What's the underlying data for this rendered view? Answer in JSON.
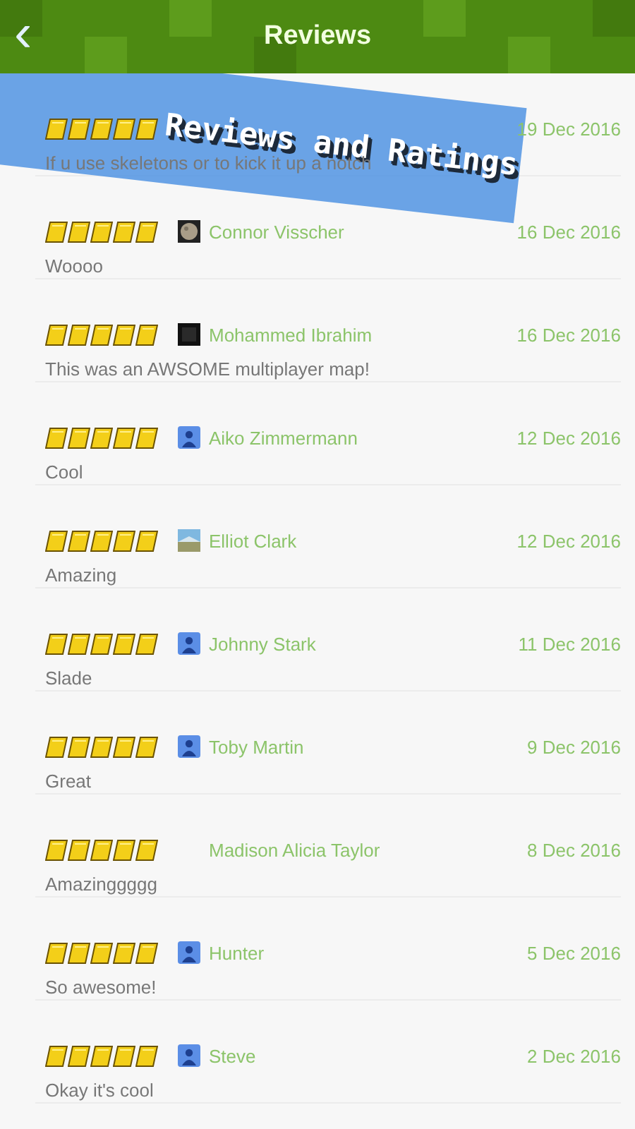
{
  "header": {
    "back_icon": "‹",
    "title": "Reviews"
  },
  "banner": {
    "text": "Reviews and Ratings"
  },
  "reviews": [
    {
      "stars": 5,
      "date": "19 Dec 2016",
      "comment": "If u use skeletons or to kick it up a notch"
    },
    {
      "stars": 5,
      "name": "Connor Visscher",
      "date": "16 Dec 2016",
      "comment": "Woooo"
    },
    {
      "stars": 5,
      "avatar": {
        "kind": "dark"
      },
      "name": "Mohammed Ibrahim",
      "date": "16 Dec 2016",
      "comment": "This was an AWSOME multiplayer map!"
    },
    {
      "stars": 5,
      "avatar": {
        "kind": "default"
      },
      "name": "Aiko Zimmermann",
      "date": "12 Dec 2016",
      "comment": "Cool"
    },
    {
      "stars": 5,
      "avatar": {
        "kind": "landscape"
      },
      "name": "Elliot Clark",
      "date": "12 Dec 2016",
      "comment": "Amazing"
    },
    {
      "stars": 5,
      "avatar": {
        "kind": "default"
      },
      "name": "Johnny Stark",
      "date": "11 Dec 2016",
      "comment": "Slade"
    },
    {
      "stars": 5,
      "avatar": {
        "kind": "default"
      },
      "name": "Toby Martin",
      "date": "9 Dec 2016",
      "comment": "Great"
    },
    {
      "stars": 5,
      "name": "Madison Alicia Taylor",
      "date": "8 Dec 2016",
      "comment": "Amazinggggg"
    },
    {
      "stars": 5,
      "avatar": {
        "kind": "default"
      },
      "name": "Hunter",
      "date": "5 Dec 2016",
      "comment": "So awesome!"
    },
    {
      "stars": 5,
      "avatar": {
        "kind": "default"
      },
      "name": "Steve",
      "date": "2 Dec 2016",
      "comment": "Okay it's cool"
    }
  ]
}
